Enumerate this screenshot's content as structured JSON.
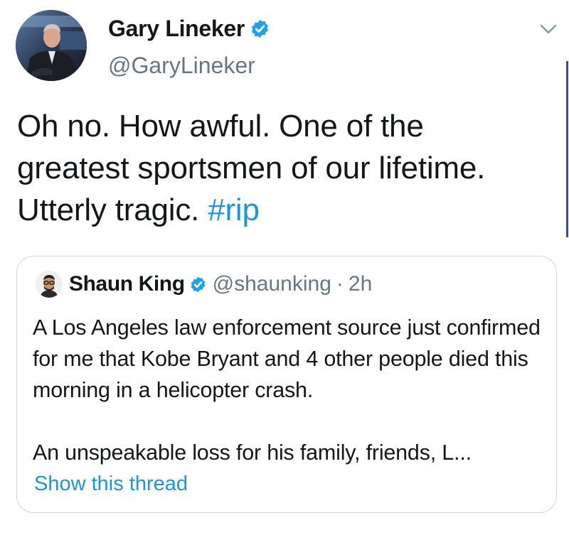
{
  "tweet": {
    "author": {
      "name": "Gary Lineker",
      "handle": "@GaryLineker",
      "verified": true
    },
    "text": "Oh no. How awful. One of the greatest sportsmen of our lifetime. Utterly tragic.",
    "hashtag": "#rip"
  },
  "quoted": {
    "author": {
      "name": "Shaun King",
      "handle": "@shaunking",
      "verified": true
    },
    "separator": "·",
    "time": "2h",
    "paragraphs": [
      "A Los Angeles law enforcement source just confirmed for me that Kobe Bryant and 4 other people died this morning in a helicopter crash.",
      "An unspeakable loss for his family, friends, L..."
    ],
    "show_thread": "Show this thread"
  },
  "colors": {
    "link": "#1b95e0",
    "secondary_text": "#657786",
    "border": "#ccd6dd",
    "verified_badge": "#1da1f2"
  },
  "icons": {
    "verified": "verified-badge-icon",
    "menu": "chevron-down-icon"
  }
}
